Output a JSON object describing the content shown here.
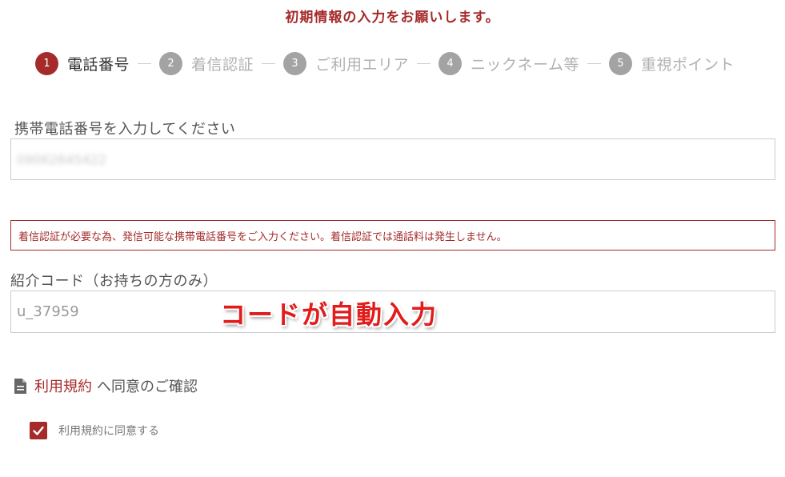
{
  "page": {
    "title": "初期情報の入力をお願いします。"
  },
  "colors": {
    "accent": "#a52b2b",
    "inactive_step": "#a3a3a3",
    "callout": "#e21b1b"
  },
  "stepper": {
    "steps": [
      {
        "number": "1",
        "label": "電話番号",
        "active": true
      },
      {
        "number": "2",
        "label": "着信認証",
        "active": false
      },
      {
        "number": "3",
        "label": "ご利用エリア",
        "active": false
      },
      {
        "number": "4",
        "label": "ニックネーム等",
        "active": false
      },
      {
        "number": "5",
        "label": "重視ポイント",
        "active": false
      }
    ]
  },
  "phone": {
    "label": "携帯電話番号を入力してください",
    "value": "09062645422"
  },
  "alert": {
    "text": "着信認証が必要な為、発信可能な携帯電話番号をご入力ください。着信認証では通話料は発生しません。"
  },
  "referral": {
    "label": "紹介コード（お持ちの方のみ）",
    "value": "u_37959"
  },
  "annotation": {
    "text": "コードが自動入力"
  },
  "terms": {
    "icon": "document-icon",
    "link_text": "利用規約",
    "rest_text": "へ同意のご確認"
  },
  "agree": {
    "label": "利用規約に同意する",
    "checked": true,
    "icon": "checkmark-icon"
  }
}
